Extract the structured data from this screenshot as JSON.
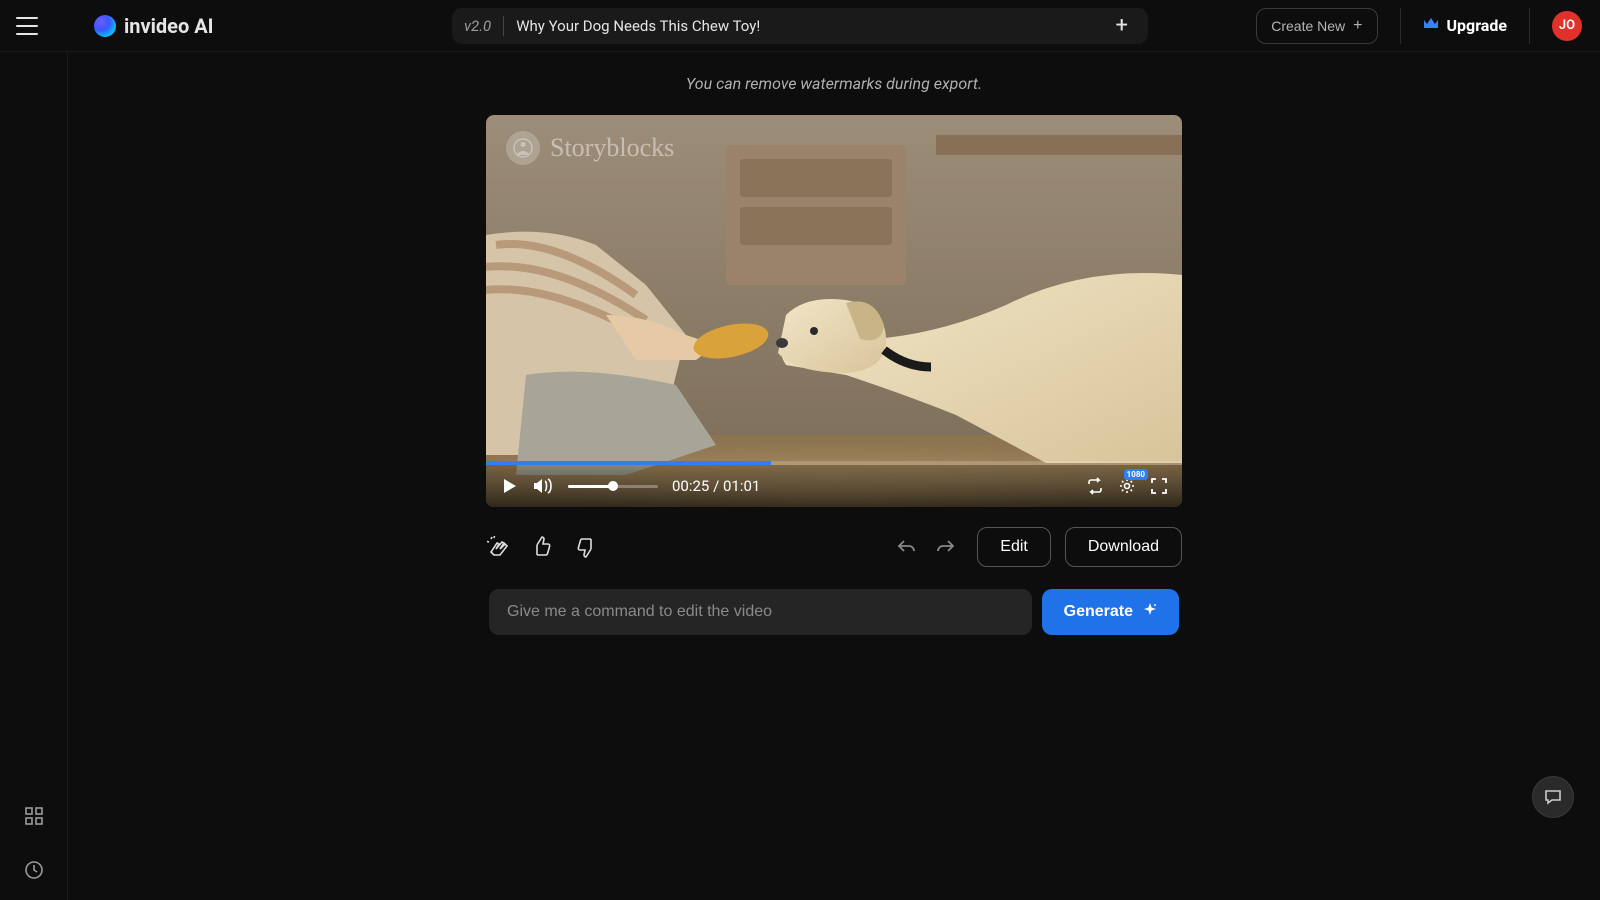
{
  "header": {
    "logo_text": "invideo AI",
    "version": "v2.0",
    "project_title": "Why Your Dog Needs This Chew Toy!",
    "create_new_label": "Create New",
    "upgrade_label": "Upgrade",
    "avatar_initials": "JO"
  },
  "hint": "You can remove watermarks during export.",
  "video": {
    "watermark": "Storyblocks",
    "progress_percent": 41,
    "time_current": "00:25",
    "time_total": "01:01",
    "volume_percent": 50,
    "quality_label": "1080"
  },
  "actions": {
    "edit_label": "Edit",
    "download_label": "Download"
  },
  "command": {
    "placeholder": "Give me a command to edit the video",
    "generate_label": "Generate"
  }
}
